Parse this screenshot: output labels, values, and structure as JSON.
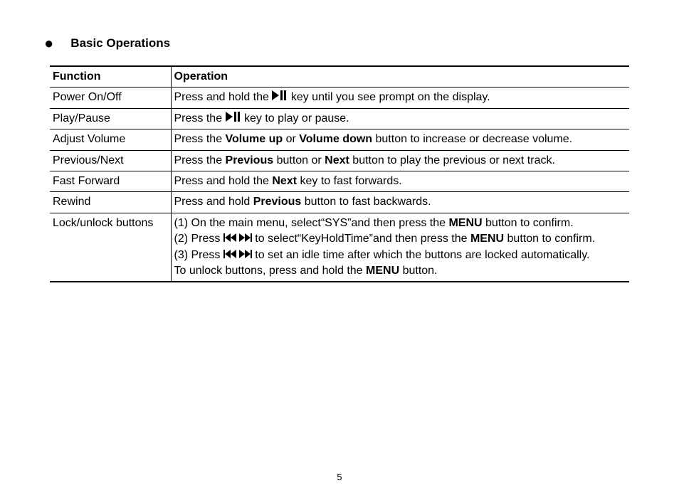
{
  "heading": "Basic Operations",
  "columns": {
    "function": "Function",
    "operation": "Operation"
  },
  "rows": {
    "power": {
      "func": "Power On/Off"
    },
    "play": {
      "func": "Play/Pause"
    },
    "volume": {
      "func": "Adjust Volume"
    },
    "prevnext": {
      "func": "Previous/Next"
    },
    "ff": {
      "func": "Fast Forward"
    },
    "rewind": {
      "func": "Rewind"
    },
    "lock": {
      "func": "Lock/unlock buttons"
    }
  },
  "text": {
    "power_a": "Press and hold the ",
    "power_b": " key until you see prompt on the display.",
    "play_a": "Press the ",
    "play_b": " key to play or pause.",
    "vol_a": "Press the ",
    "vol_up": "Volume up",
    "vol_or": " or ",
    "vol_down": "Volume down",
    "vol_b": " button to increase or decrease volume.",
    "pn_a": "Press the ",
    "pn_prev": "Previous",
    "pn_mid": " button or ",
    "pn_next": "Next",
    "pn_b": " button to play the previous or next track.",
    "ff_a": "Press and hold the ",
    "ff_next": "Next",
    "ff_b": " key to fast forwards.",
    "rw_a": "Press and hold ",
    "rw_prev": "Previous",
    "rw_b": " button to fast backwards.",
    "lock_1a": "(1) On the main menu, select“SYS”and then press the ",
    "menu": "MENU",
    "lock_1b": " button to confirm.",
    "lock_2a": "(2) Press ",
    "lock_2b": " to  select“KeyHoldTime”and  then  press  the  ",
    "lock_2c": " button to confirm.",
    "lock_3a": "(3) Press ",
    "lock_3b": " to set an idle time after which the buttons are locked automatically.",
    "lock_4a": "To unlock buttons, press and hold the ",
    "lock_4b": " button."
  },
  "page_number": "5"
}
